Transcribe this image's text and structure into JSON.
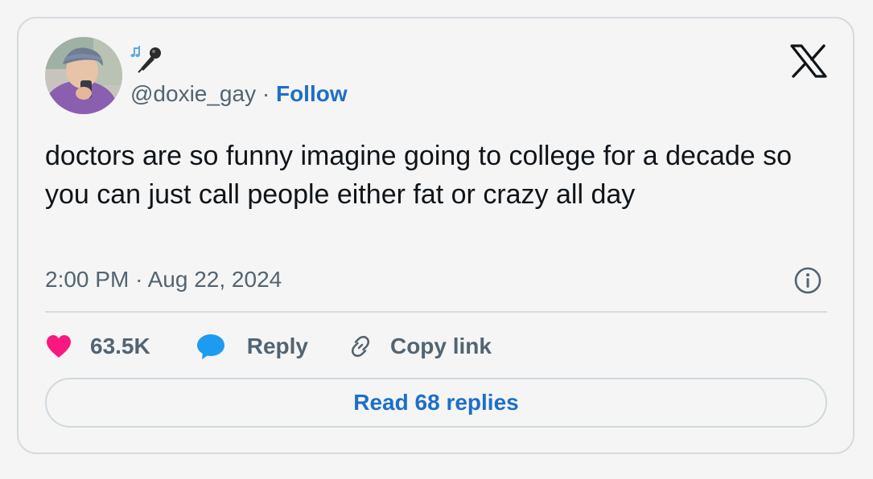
{
  "tweet": {
    "display_name_emoji": "🎶🎤",
    "handle": "@doxie_gay",
    "separator": "·",
    "follow_label": "Follow",
    "text": "doctors are so funny imagine going to college for a decade so you can just call people either fat or crazy all day",
    "time": "2:00 PM",
    "date_separator": "·",
    "date": "Aug 22, 2024"
  },
  "actions": {
    "like_count": "63.5K",
    "reply_label": "Reply",
    "copy_link_label": "Copy link"
  },
  "read_replies_label": "Read 68 replies",
  "icons": {
    "brand": "x-logo-icon",
    "info": "info-icon",
    "like": "heart-icon",
    "reply": "speech-bubble-icon",
    "copy": "link-icon"
  },
  "colors": {
    "like": "#f91880",
    "reply": "#1d9bf0",
    "link": "#1d6fc7",
    "muted": "#536471",
    "border": "#d6dbe0"
  }
}
